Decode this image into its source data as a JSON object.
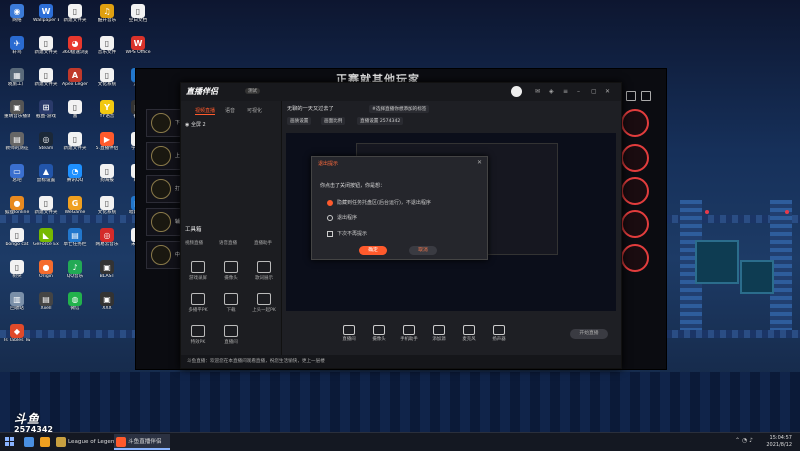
{
  "desktop_icons": [
    {
      "label": "网络",
      "color": "#3b7bd8",
      "glyph": "◉"
    },
    {
      "label": "轩鸟",
      "color": "#2a6bd1",
      "glyph": "✈"
    },
    {
      "label": "晓旅工厂",
      "color": "#5a6a7a",
      "glyph": "▦"
    },
    {
      "label": "重晴音乐播课",
      "color": "#555",
      "glyph": "▣"
    },
    {
      "label": "教师的测征",
      "color": "#666",
      "glyph": "▤"
    },
    {
      "label": "总吧",
      "color": "#3a6fcf",
      "glyph": "▭"
    },
    {
      "label": "狐狸Ionline",
      "color": "#e88a20",
      "glyph": "●"
    },
    {
      "label": "bongo cat",
      "color": "#f2f2f2",
      "glyph": "▯"
    },
    {
      "label": "树突",
      "color": "#f2f2f2",
      "glyph": "▯"
    },
    {
      "label": "回收站",
      "color": "#7a8fa8",
      "glyph": "▥"
    },
    {
      "label": "Is Tables Two F...",
      "color": "#e04a2a",
      "glyph": "◆"
    },
    {
      "label": "Wallpaper Engine:...",
      "color": "#2d6fd8",
      "glyph": "W"
    },
    {
      "label": "新建文件夹",
      "color": "#f2f2f2",
      "glyph": "▯"
    },
    {
      "label": "新建文件夹",
      "color": "#f2f2f2",
      "glyph": "▯"
    },
    {
      "label": "截图-游戏",
      "color": "#2a3a6a",
      "glyph": "⊞"
    },
    {
      "label": "Steam",
      "color": "#1b2838",
      "glyph": "◎"
    },
    {
      "label": "鼠标设置",
      "color": "#2255aa",
      "glyph": "▲"
    },
    {
      "label": "新建文件夹",
      "color": "#f2f2f2",
      "glyph": "▯"
    },
    {
      "label": "GeForce Experience",
      "color": "#76b900",
      "glyph": "◣"
    },
    {
      "label": "Origin",
      "color": "#f56c2d",
      "glyph": "●"
    },
    {
      "label": "Xxell",
      "color": "#444",
      "glyph": "▤"
    },
    {
      "label": "新建文件夹",
      "color": "#f2f2f2",
      "glyph": "▯"
    },
    {
      "label": "360极速浏览器",
      "color": "#e8382d",
      "glyph": "◕"
    },
    {
      "label": "Apex Legends",
      "color": "#c0392b",
      "glyph": "A"
    },
    {
      "label": "富",
      "color": "#f2f2f2",
      "glyph": "▯"
    },
    {
      "label": "新建文件夹",
      "color": "#f2f2f2",
      "glyph": "▯"
    },
    {
      "label": "腾讯QQ",
      "color": "#1e90ff",
      "glyph": "◔"
    },
    {
      "label": "WeGame",
      "color": "#f0a020",
      "glyph": "G"
    },
    {
      "label": "草亡任务栏",
      "color": "#2277cc",
      "glyph": "▤"
    },
    {
      "label": "QQ音乐",
      "color": "#22aa55",
      "glyph": "♪"
    },
    {
      "label": "微信",
      "color": "#22b24c",
      "glyph": "◍"
    },
    {
      "label": "酷开音乐",
      "color": "#e0a010",
      "glyph": "♫"
    },
    {
      "label": "音乐文件",
      "color": "#f2f2f2",
      "glyph": "▯"
    },
    {
      "label": "文化系统",
      "color": "#f2f2f2",
      "glyph": "▯"
    },
    {
      "label": "YY语音",
      "color": "#f2c811",
      "glyph": "Y"
    },
    {
      "label": "5.直播伴侣",
      "color": "#ff5a2c",
      "glyph": "▶"
    },
    {
      "label": "狗海报",
      "color": "#f2f2f2",
      "glyph": "▯"
    },
    {
      "label": "文化系统",
      "color": "#f2f2f2",
      "glyph": "▯"
    },
    {
      "label": "网易云音乐",
      "color": "#d42a2a",
      "glyph": "◎"
    },
    {
      "label": "BLAST",
      "color": "#333",
      "glyph": "▣"
    },
    {
      "label": "XXX",
      "color": "#333",
      "glyph": "▣"
    },
    {
      "label": "空白文档",
      "color": "#f2f2f2",
      "glyph": "▯"
    },
    {
      "label": "WPS Office",
      "color": "#d9322a",
      "glyph": "W"
    },
    {
      "label": "流量",
      "color": "#2277cc",
      "glyph": "◑"
    },
    {
      "label": "截图",
      "color": "#333",
      "glyph": "▣"
    },
    {
      "label": "学生证",
      "color": "#f2f2f2",
      "glyph": "▯"
    },
    {
      "label": "系统",
      "color": "#f2f2f2",
      "glyph": "▯"
    },
    {
      "label": "暗影精灵",
      "color": "#2277cc",
      "glyph": "▤"
    },
    {
      "label": "未文件",
      "color": "#f2f2f2",
      "glyph": "▯"
    }
  ],
  "game": {
    "title": "正赛就其他玩家",
    "slots": [
      "下",
      "上",
      "打",
      "辅",
      "中"
    ]
  },
  "app": {
    "logo": "直播伴侣",
    "beta": "测试",
    "left_tabs": [
      "视频直播",
      "语音",
      "可视化"
    ],
    "scene": "全屏 2",
    "tools_header": "工具箱",
    "sub_tabs": [
      "视频直播",
      "语音直播",
      "直播助手"
    ],
    "tools": [
      {
        "name": "tool-game",
        "label": "游戏录屏"
      },
      {
        "name": "tool-camera",
        "label": "摄像头"
      },
      {
        "name": "tool-music",
        "label": "歌词展示"
      },
      {
        "name": "tool-pk",
        "label": "多播平PK"
      },
      {
        "name": "tool-download",
        "label": "下载"
      },
      {
        "name": "tool-connect",
        "label": "上头一起PK"
      },
      {
        "name": "tool-effect",
        "label": "特效PK"
      },
      {
        "name": "tool-room",
        "label": "直播间"
      }
    ],
    "stream_title": "无聊的一天又过去了",
    "stream_category": "#选择直播你想添加的标签",
    "chips": [
      "画质设置",
      "画面比例",
      "直播设置 2574342"
    ],
    "dialog": {
      "title": "退出提示",
      "question": "你点击了关闭按钮，你是想：",
      "option1": "隐藏到任务托盘区(后台运行)，不退出程序",
      "option2": "退出程序",
      "checkbox": "下次不再提示",
      "ok": "确定",
      "cancel": "取消"
    },
    "bottom_tools": [
      "直播间",
      "摄像头",
      "手机助手",
      "添加源",
      "麦克风",
      "扬声器"
    ],
    "start_button": "开始直播",
    "status": "斗鱼直播：欢迎您在本直播间观看直播，祝您生活愉快，更上一层楼"
  },
  "watermark": {
    "logo": "斗鱼",
    "room_id": "2574342"
  },
  "taskbar": {
    "tasks": [
      {
        "label": "",
        "color": "#4a90e2"
      },
      {
        "label": "",
        "color": "#f0a020"
      },
      {
        "label": "League of Legends",
        "color": "#c8a040"
      },
      {
        "label": "斗鱼直播伴侣",
        "color": "#ff5a2c"
      }
    ],
    "time": "15:04:57",
    "date": "2021/8/12"
  }
}
